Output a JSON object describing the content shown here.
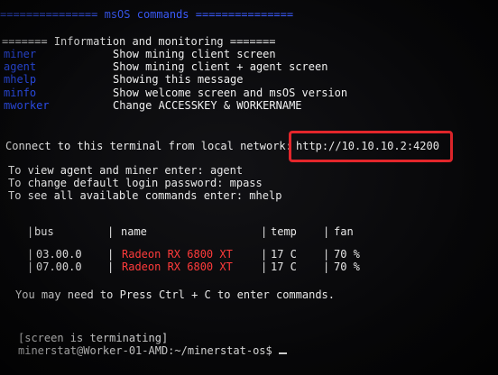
{
  "header": {
    "title_line": "=============== msOS commands ==============="
  },
  "info_section": {
    "heading": "======= Information and monitoring =======",
    "commands": [
      {
        "cmd": "miner",
        "desc": "Show mining client screen"
      },
      {
        "cmd": "agent",
        "desc": "Show mining client + agent screen"
      },
      {
        "cmd": "mhelp",
        "desc": "Showing this message"
      },
      {
        "cmd": "minfo",
        "desc": "Show welcome screen and msOS version"
      },
      {
        "cmd": "mworker",
        "desc": "Change ACCESSKEY & WORKERNAME"
      }
    ]
  },
  "network": {
    "label": "Connect to this terminal from local network:",
    "url": "http://10.10.10.2:4200",
    "highlight_color": "#e3262b"
  },
  "tips": [
    "To view agent and miner enter: agent",
    "To change default login password: mpass",
    "To see all available commands enter: mhelp"
  ],
  "gpu_table": {
    "headers": {
      "bus": "bus",
      "name": "name",
      "temp": "temp",
      "fan": "fan"
    },
    "rows": [
      {
        "bus": "03.00.0",
        "name": "Radeon RX 6800 XT",
        "temp": "17 C",
        "fan": "70 %"
      },
      {
        "bus": "07.00.0",
        "name": "Radeon RX 6800 XT",
        "temp": "17 C",
        "fan": "70 %"
      }
    ]
  },
  "ctrl_c_message": "You may need to Press Ctrl + C to enter commands.",
  "screen_status": "[screen is terminating]",
  "prompt": "minerstat@Worker-01-AMD:~/minerstat-os$",
  "colors": {
    "command_blue": "#2f54ff",
    "gpu_name_red": "#ff3b3b",
    "text": "#e6e6e6",
    "background": "#08080a"
  }
}
